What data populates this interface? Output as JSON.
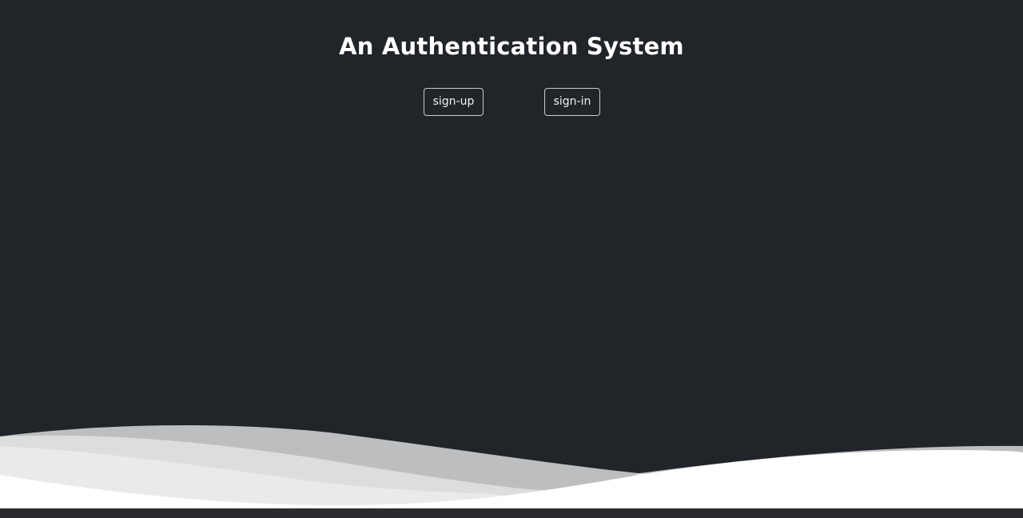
{
  "page": {
    "title": "An Authentication System"
  },
  "actions": {
    "signup_label": "sign-up",
    "signin_label": "sign-in"
  },
  "colors": {
    "background": "#212428",
    "text": "#ffffff",
    "button_border": "#c8cacc",
    "wave_dark": "#bcbec0",
    "wave_mid": "#dcdddd",
    "wave_light": "#e9eaea",
    "wave_front": "#ffffff"
  }
}
